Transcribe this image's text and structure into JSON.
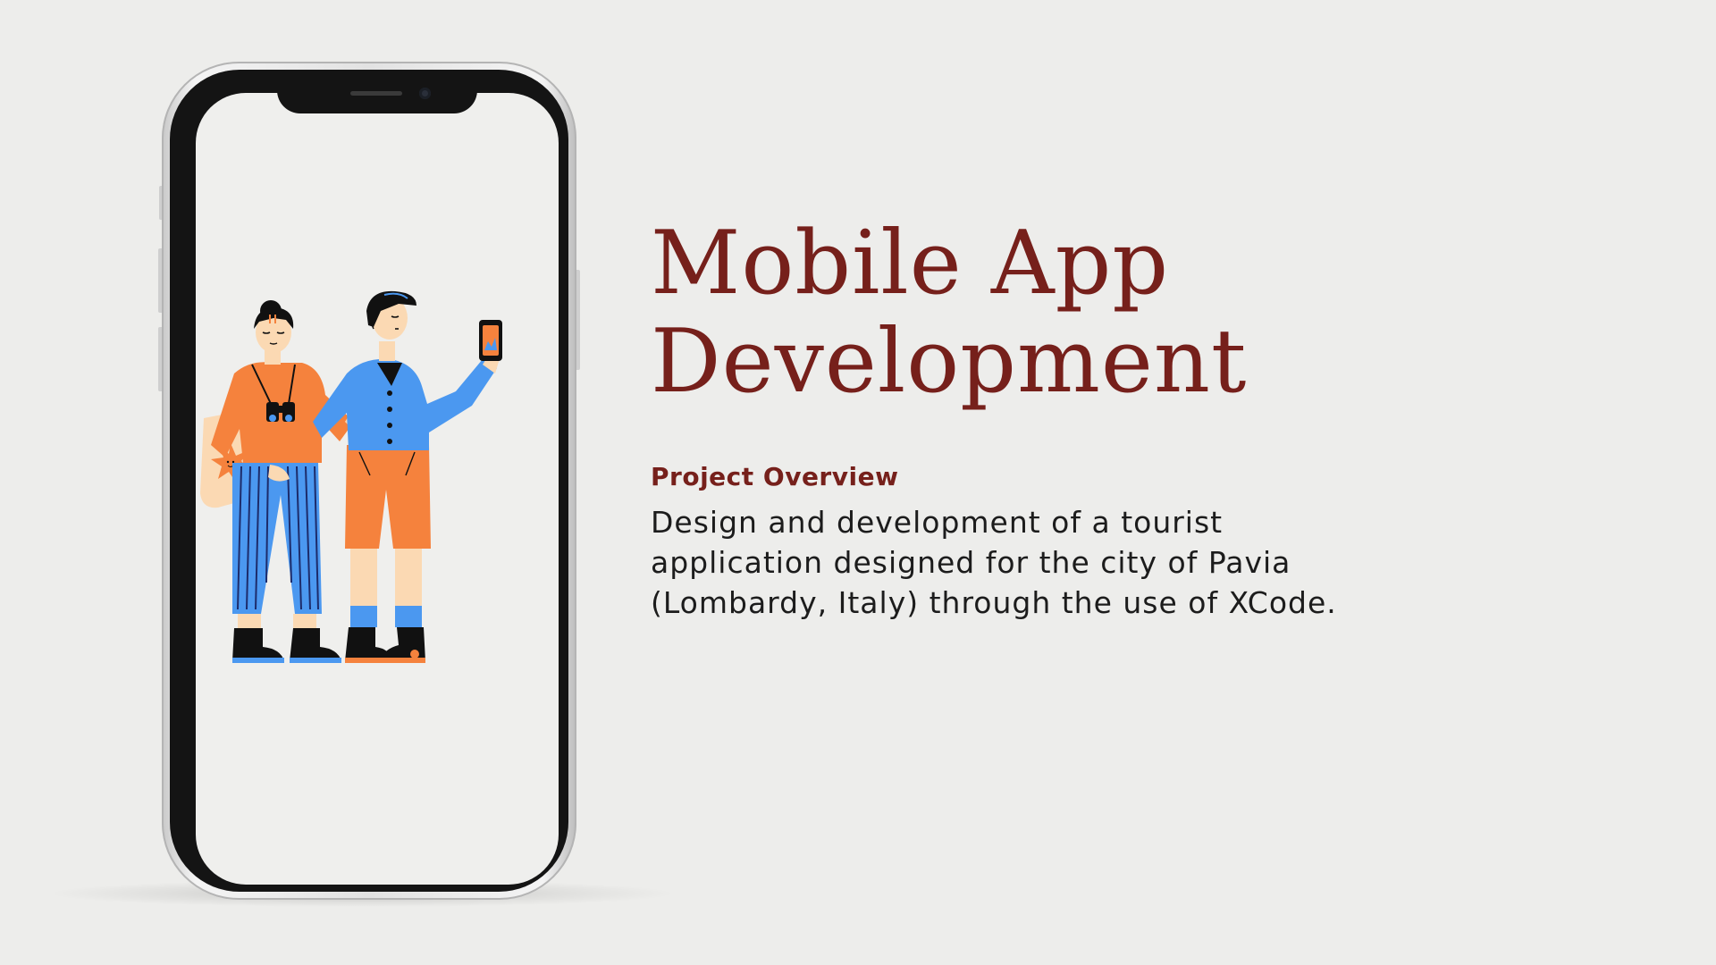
{
  "slide": {
    "title_line1": "Mobile App",
    "title_line2": "Development",
    "section_label": "Project Overview",
    "description_line1": "Design and development of a tourist",
    "description_line2": "application designed for the city of Pavia",
    "description_line3": "(Lombardy, Italy) through the use of XCode."
  },
  "colors": {
    "background": "#ededeb",
    "title": "#76201b",
    "body_text": "#1c1c1c",
    "phone_bezel": "#141414",
    "screen": "#efefed",
    "illustration_orange": "#f5823d",
    "illustration_blue": "#4b98f0",
    "illustration_skin": "#fbd9b3"
  },
  "illustration": {
    "subject": "two tourists, one holding binoculars and a tote bag, one taking a photo with a phone"
  }
}
